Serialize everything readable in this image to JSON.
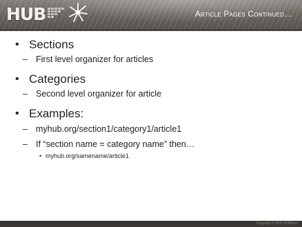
{
  "header": {
    "logo_text": "HUB",
    "title": "Article Pages Continued…"
  },
  "content": {
    "items": [
      {
        "label": "Sections",
        "children": [
          {
            "label": "First level organizer for articles"
          }
        ]
      },
      {
        "label": "Categories",
        "children": [
          {
            "label": "Second level organizer for article"
          }
        ]
      },
      {
        "label": "Examples:",
        "children": [
          {
            "label": "myhub.org/section1/category1/article1"
          },
          {
            "label": "If “section name = category name” then…",
            "children": [
              {
                "label": "myhub.org/samename/article1"
              }
            ]
          }
        ]
      }
    ]
  },
  "footer": {
    "text": "Copyright © 2011 HUBzero"
  },
  "colors": {
    "header": "#6f6a64",
    "header_rule": "#46423e",
    "footer": "#3a3734",
    "text": "#1f1f1f"
  },
  "icons": {
    "logo_grid": "hub-grid-icon",
    "logo_burst": "starburst-icon"
  }
}
